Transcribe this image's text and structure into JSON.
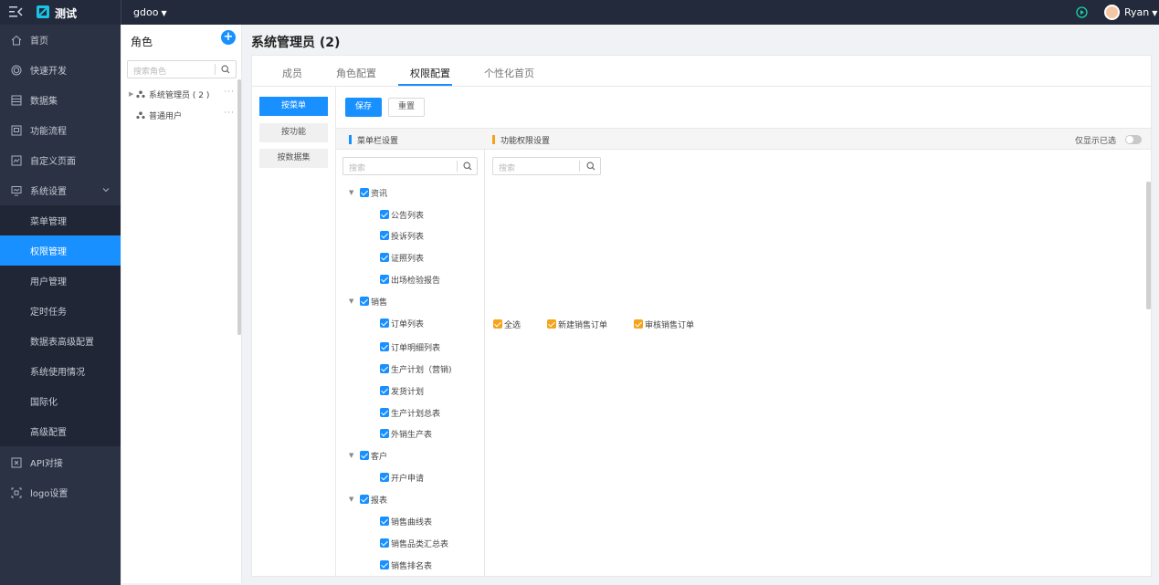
{
  "topbar": {
    "app_name": "测试",
    "workspace": "gdoo",
    "user": "Ryan"
  },
  "sidebar": {
    "items": [
      {
        "label": "首页",
        "icon": "home-icon"
      },
      {
        "label": "快速开发",
        "icon": "cube-icon"
      },
      {
        "label": "数据集",
        "icon": "database-icon"
      },
      {
        "label": "功能流程",
        "icon": "flow-icon"
      },
      {
        "label": "自定义页面",
        "icon": "page-icon"
      },
      {
        "label": "系统设置",
        "icon": "monitor-icon"
      }
    ],
    "sub_items": [
      "菜单管理",
      "权限管理",
      "用户管理",
      "定时任务",
      "数据表高级配置",
      "系统使用情况",
      "国际化",
      "高级配置"
    ],
    "bottom_items": [
      {
        "label": "API对接",
        "icon": "api-icon"
      },
      {
        "label": "logo设置",
        "icon": "logo-setting-icon"
      }
    ]
  },
  "roles": {
    "title": "角色",
    "search_placeholder": "搜索角色",
    "items": [
      {
        "label": "系统管理员 ( 2 )"
      },
      {
        "label": "普通用户"
      }
    ],
    "more": "···"
  },
  "main": {
    "title": "系统管理员 (2)",
    "tabs": [
      "成员",
      "角色配置",
      "权限配置",
      "个性化首页"
    ],
    "active_tab": "权限配置",
    "modes": [
      "按菜单",
      "按功能",
      "按数据集"
    ],
    "save_label": "保存",
    "reset_label": "重置",
    "menu_header": "菜单栏设置",
    "perm_header": "功能权限设置",
    "show_selected_label": "仅显示已选",
    "search_placeholder": "搜索",
    "tree": [
      {
        "label": "资讯",
        "children": [
          "公告列表",
          "投诉列表",
          "证照列表",
          "出场检验报告"
        ]
      },
      {
        "label": "销售",
        "children": [
          "订单列表",
          "订单明细列表",
          "生产计划（营销)",
          "发货计划",
          "生产计划总表",
          "外销生产表"
        ]
      },
      {
        "label": "客户",
        "children": [
          "开户申请"
        ]
      },
      {
        "label": "报表",
        "children": [
          "销售曲线表",
          "销售品类汇总表",
          "销售排名表"
        ]
      }
    ],
    "permissions": [
      "全选",
      "新建销售订单",
      "审核销售订单"
    ]
  },
  "colors": {
    "accent": "#1890ff",
    "sidebar_bg": "#2b3243",
    "topbar_bg": "#232a3b",
    "warning": "#f5a31a"
  }
}
